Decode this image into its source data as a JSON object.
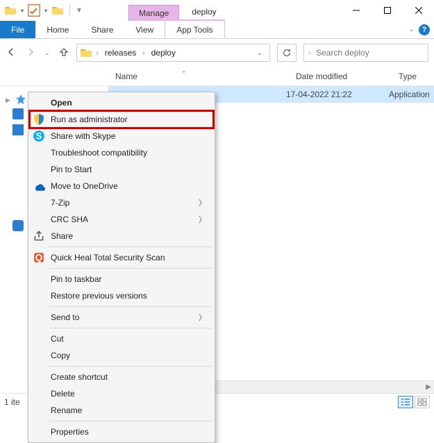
{
  "title": {
    "contextual_tab": "Manage",
    "window_title": "deploy"
  },
  "ribbon": {
    "file": "File",
    "home": "Home",
    "share": "Share",
    "view": "View",
    "app_tools": "App Tools",
    "help_char": "?"
  },
  "nav": {
    "crumbs": [
      "releases",
      "deploy"
    ]
  },
  "search": {
    "placeholder": "Search deploy"
  },
  "columns": {
    "name": "Name",
    "date": "Date modified",
    "type": "Type"
  },
  "sidebar": {
    "quick_access": "Quick access"
  },
  "rows": [
    {
      "date": "17-04-2022 21:22",
      "type": "Application"
    }
  ],
  "context_menu": {
    "open": "Open",
    "run_admin": "Run as administrator",
    "skype": "Share with Skype",
    "troubleshoot": "Troubleshoot compatibility",
    "pin_start": "Pin to Start",
    "onedrive": "Move to OneDrive",
    "seven_zip": "7-Zip",
    "crc": "CRC SHA",
    "share": "Share",
    "quickheal": "Quick Heal Total Security Scan",
    "pin_taskbar": "Pin to taskbar",
    "restore": "Restore previous versions",
    "send_to": "Send to",
    "cut": "Cut",
    "copy": "Copy",
    "shortcut": "Create shortcut",
    "delete": "Delete",
    "rename": "Rename",
    "properties": "Properties"
  },
  "status": {
    "text": "1 ite"
  }
}
